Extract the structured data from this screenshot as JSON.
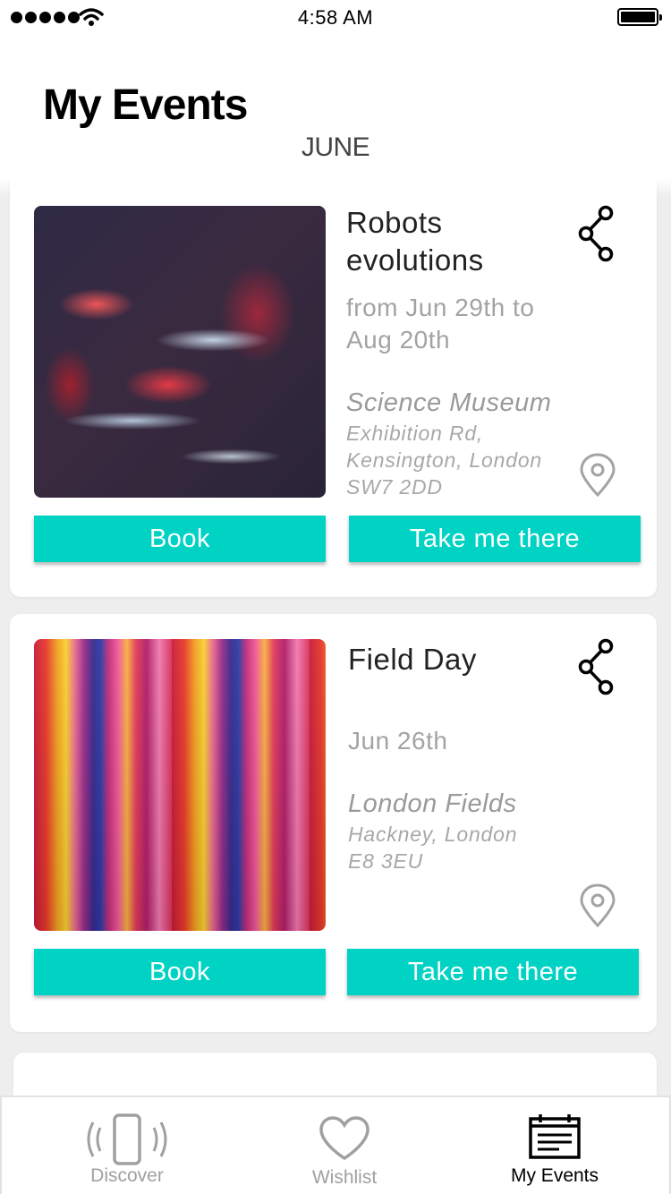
{
  "status_bar": {
    "time": "4:58 AM"
  },
  "header": {
    "title": "My Events",
    "month": "JUNE"
  },
  "events": [
    {
      "title": "Robots evolutions",
      "dates": "from Jun 29th to Aug 20th",
      "venue": "Science Museum",
      "address": "Exhibition Rd, Kensington, London SW7 2DD",
      "book_label": "Book",
      "directions_label": "Take me there"
    },
    {
      "title": "Field Day",
      "dates": "Jun 26th",
      "venue": "London Fields",
      "address": "Hackney, London E8 3EU",
      "book_label": "Book",
      "directions_label": "Take me there"
    }
  ],
  "tab_bar": {
    "tabs": [
      {
        "label": "Discover",
        "icon": "phone-vibrate-icon",
        "active": false
      },
      {
        "label": "Wishlist",
        "icon": "heart-icon",
        "active": false
      },
      {
        "label": "My Events",
        "icon": "calendar-icon",
        "active": true
      }
    ]
  },
  "colors": {
    "accent": "#00d2c3",
    "muted_text": "#a3a3a3",
    "background": "#eeeeee"
  }
}
